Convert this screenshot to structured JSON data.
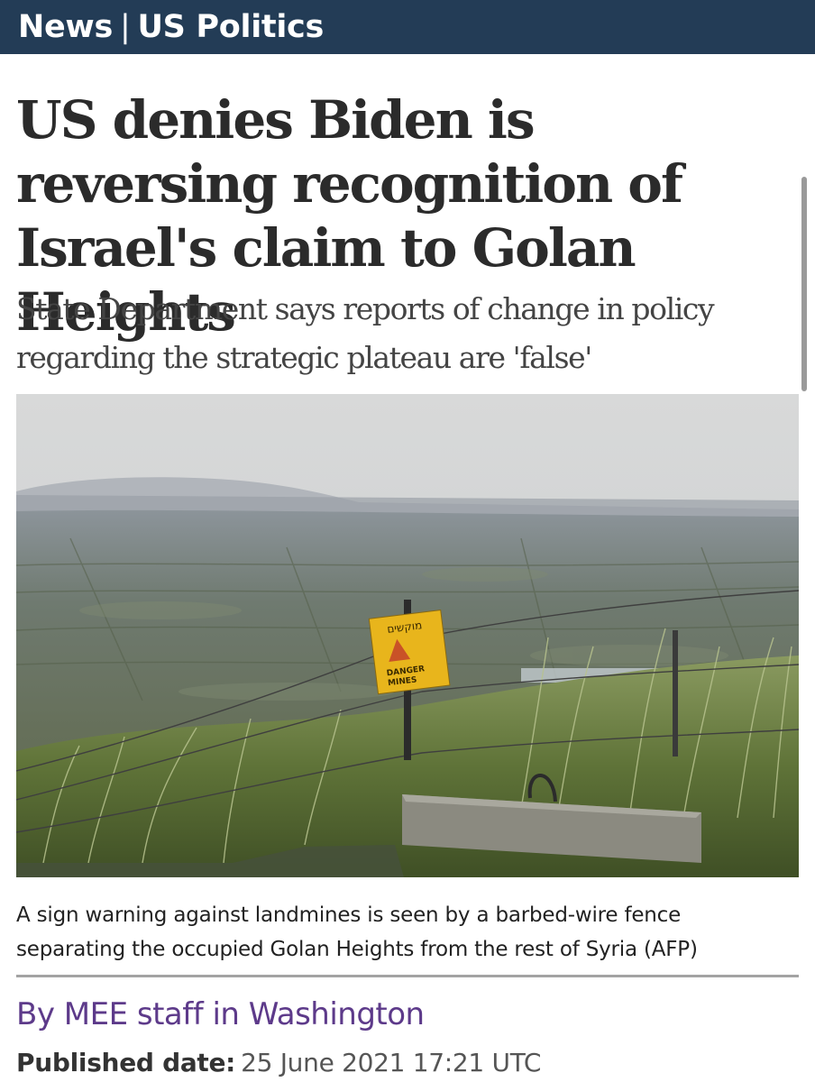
{
  "header": {
    "section": "News",
    "separator": "|",
    "subsection": "US Politics",
    "background": "#233c56"
  },
  "article": {
    "headline": "US denies Biden is reversing recognition of Israel's claim to Golan Heights",
    "standfirst": "State Department says reports of change in policy regarding the strategic plateau are 'false'",
    "image": {
      "caption": "A sign warning against landmines is seen by a barbed-wire fence separating the occupied Golan Heights from the rest of Syria (AFP)",
      "sign_lines": [
        "מוקשים",
        "DANGER",
        "MINES"
      ]
    },
    "byline": "By MEE staff in Washington",
    "published_label": "Published date:",
    "published_value": "25 June 2021 17:21 UTC"
  },
  "colors": {
    "byline": "#5d3a8a",
    "sign": "#e8b51c"
  }
}
